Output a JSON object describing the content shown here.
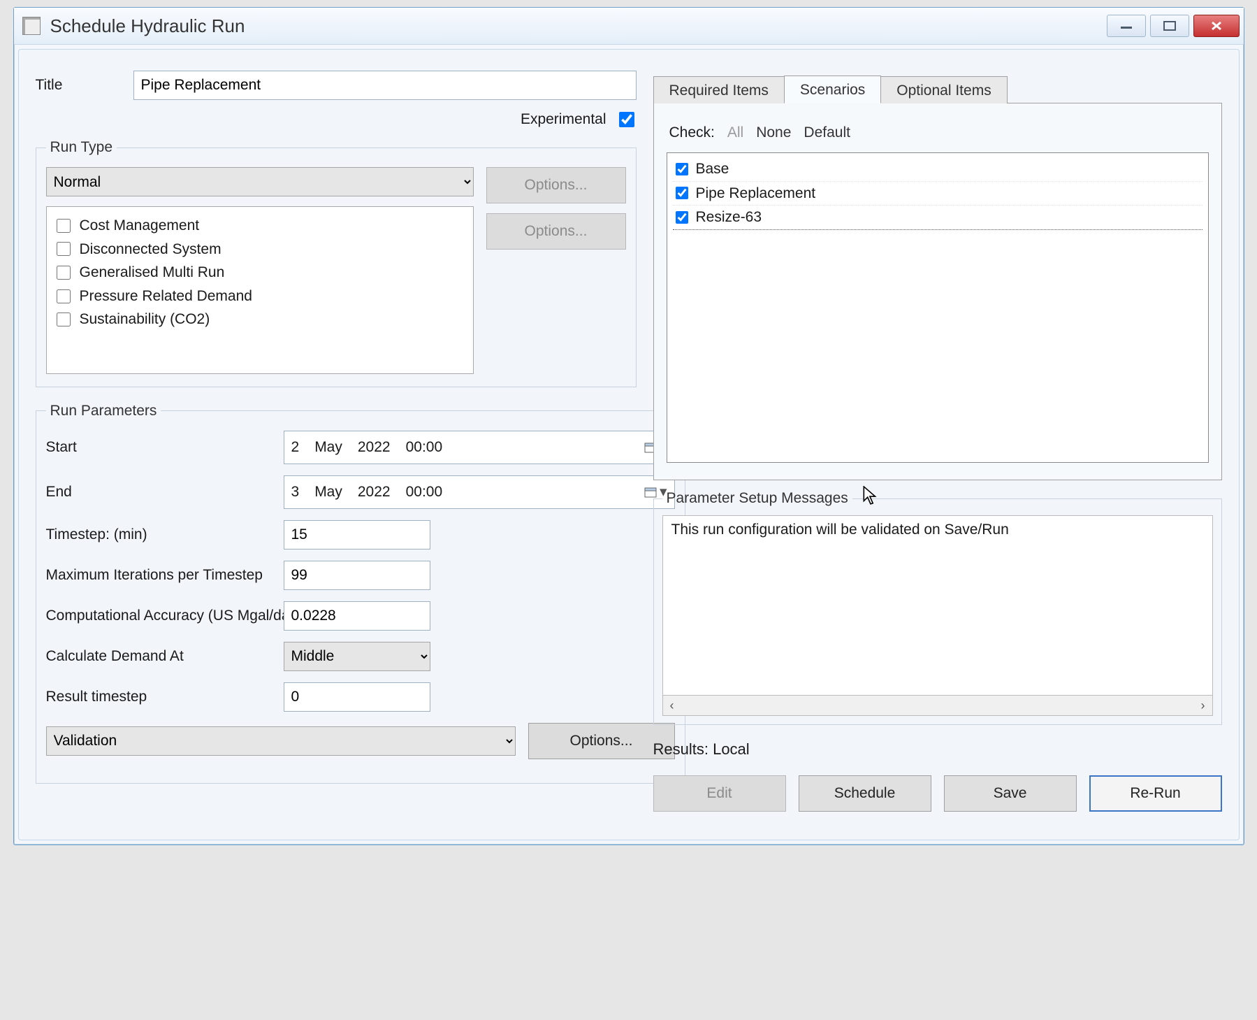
{
  "window": {
    "title": "Schedule Hydraulic Run"
  },
  "title_field": {
    "label": "Title",
    "value": "Pipe Replacement"
  },
  "experimental": {
    "label": "Experimental",
    "checked": true
  },
  "run_type": {
    "legend": "Run Type",
    "selected": "Normal",
    "options_btn1": "Options...",
    "options_btn2": "Options...",
    "flags": [
      {
        "label": "Cost Management",
        "checked": false
      },
      {
        "label": "Disconnected System",
        "checked": false
      },
      {
        "label": "Generalised Multi Run",
        "checked": false
      },
      {
        "label": "Pressure Related Demand",
        "checked": false
      },
      {
        "label": "Sustainability (CO2)",
        "checked": false
      }
    ]
  },
  "run_params": {
    "legend": "Run Parameters",
    "start_label": "Start",
    "start": {
      "day": "2",
      "month": "May",
      "year": "2022",
      "time": "00:00"
    },
    "end_label": "End",
    "end": {
      "day": "3",
      "month": "May",
      "year": "2022",
      "time": "00:00"
    },
    "timestep_label": "Timestep: (min)",
    "timestep": "15",
    "maxiter_label": "Maximum Iterations per Timestep",
    "maxiter": "99",
    "accuracy_label": "Computational Accuracy (US Mgal/day)",
    "accuracy": "0.0228",
    "calc_demand_label": "Calculate Demand At",
    "calc_demand": "Middle",
    "result_ts_label": "Result timestep",
    "result_ts": "0",
    "validation_selected": "Validation",
    "validation_options_btn": "Options..."
  },
  "tabs": {
    "required": "Required Items",
    "scenarios": "Scenarios",
    "optional": "Optional Items",
    "active": "scenarios"
  },
  "scenarios_pane": {
    "check_label": "Check:",
    "all": "All",
    "none": "None",
    "default": "Default",
    "items": [
      {
        "label": "Base",
        "checked": true
      },
      {
        "label": "Pipe Replacement",
        "checked": true
      },
      {
        "label": "Resize-63",
        "checked": true
      }
    ]
  },
  "messages": {
    "legend": "Parameter Setup Messages",
    "text": "This run configuration will be validated on Save/Run"
  },
  "results": {
    "label": "Results: Local",
    "edit": "Edit",
    "schedule": "Schedule",
    "save": "Save",
    "rerun": "Re-Run"
  }
}
